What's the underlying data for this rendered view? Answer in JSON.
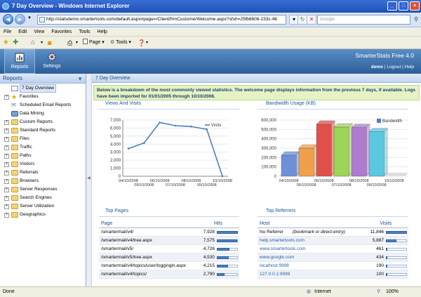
{
  "window": {
    "title": "7 Day Overview - Windows Internet Explorer"
  },
  "address": {
    "url": "http://statsdemo.smartertools.com/default.aspx#page=/Client/frmCustomerWelcome.aspx?sfsh=25fb6608-233c-46",
    "search_placeholder": "Google"
  },
  "menu": [
    "File",
    "Edit",
    "View",
    "Favorites",
    "Tools",
    "Help"
  ],
  "toolbar": {
    "page_label": "Page",
    "tools_label": "Tools"
  },
  "app": {
    "brand": "SmarterStats Free 4.0",
    "nav": [
      {
        "label": "Reports",
        "icon": "reports-icon"
      },
      {
        "label": "Settings",
        "icon": "gear-icon"
      }
    ],
    "user": "demo",
    "logout": "Logout",
    "help": "Help",
    "sep": "|"
  },
  "sidebar": {
    "title": "Reports",
    "items": [
      {
        "label": "7 Day Overview",
        "expander": false,
        "selected": true
      },
      {
        "label": "Favorites",
        "expander": true
      },
      {
        "label": "Scheduled Email Reports",
        "expander": false
      },
      {
        "label": "Data Mining",
        "expander": false
      },
      {
        "label": "Custom Reports",
        "expander": true
      },
      {
        "label": "Standard Reports",
        "expander": true
      },
      {
        "label": "Files",
        "expander": true
      },
      {
        "label": "Traffic",
        "expander": true
      },
      {
        "label": "Paths",
        "expander": true
      },
      {
        "label": "Visitors",
        "expander": true
      },
      {
        "label": "Referrals",
        "expander": true
      },
      {
        "label": "Browsers",
        "expander": true
      },
      {
        "label": "Server Responses",
        "expander": true
      },
      {
        "label": "Search Engines",
        "expander": true
      },
      {
        "label": "Server Utilization",
        "expander": true
      },
      {
        "label": "Geographics",
        "expander": true
      }
    ]
  },
  "main": {
    "title": "7 Day Overview",
    "info": "Below is a breakdown of the most commonly viewed statistics. The welcome page displays information from the previous 7 days, if available. Logs have been imported for 01/01/2005 through 10/10/2008.",
    "views_title": "Views And Visits",
    "bandwidth_title": "Bandwidth Usage (KB)",
    "top_pages_title": "Top Pages",
    "top_referrers_title": "Top Referrers",
    "pages_header": {
      "page": "Page",
      "hits": "Hits"
    },
    "referrers_header": {
      "host": "Host",
      "visits": "Visits"
    },
    "pages": [
      {
        "page": "/smartermail/v4/",
        "hits": "7,928",
        "frac": 1.0
      },
      {
        "page": "/smartermail/v4/tree.aspx",
        "hits": "7,575",
        "frac": 0.955
      },
      {
        "page": "/smartermail/v5/",
        "hits": "4,726",
        "frac": 0.596
      },
      {
        "page": "/smartermail/v5/tree.aspx",
        "hits": "4,530",
        "frac": 0.571
      },
      {
        "page": "/smartermail/v4/topics/user/loggingin.aspx",
        "hits": "4,215",
        "frac": 0.532
      },
      {
        "page": "/smartermail/v4/topics/",
        "hits": "2,790",
        "frac": 0.352
      }
    ],
    "referrers": [
      {
        "host": "No Referrer",
        "note": "(bookmark or direct-entry)",
        "visits": "11,846",
        "frac": 1.0,
        "link": false
      },
      {
        "host": "help.smartertools.com",
        "visits": "5,887",
        "frac": 0.497,
        "link": true
      },
      {
        "host": "www.smartertools.com",
        "visits": "461",
        "frac": 0.039,
        "link": true
      },
      {
        "host": "www.google.com",
        "visits": "434",
        "frac": 0.037,
        "link": true
      },
      {
        "host": "localhost:9998",
        "visits": "190",
        "frac": 0.016,
        "link": true
      },
      {
        "host": "127.0.0.1:9999",
        "visits": "100",
        "frac": 0.008,
        "link": true
      }
    ]
  },
  "chart_data": [
    {
      "type": "line",
      "title": "Views And Visits",
      "x": [
        "04/10/2008",
        "05/10/2008",
        "06/10/2008",
        "07/10/2008",
        "08/10/2008",
        "09/10/2008",
        "10/10/2008"
      ],
      "series": [
        {
          "name": "Visits",
          "values": [
            3450,
            4150,
            6700,
            6300,
            6200,
            5850,
            0
          ]
        }
      ],
      "ylim": [
        0,
        7000
      ],
      "yticks": [
        "0",
        "1,000",
        "2,000",
        "3,000",
        "4,000",
        "5,000",
        "6,000",
        "7,000"
      ],
      "color": "#4a7fc0",
      "legend": "top-right"
    },
    {
      "type": "bar",
      "title": "Bandwidth Usage (KB)",
      "categories": [
        "04/10/2008",
        "05/10/2008",
        "06/10/2008",
        "07/10/2008",
        "08/10/2008",
        "09/10/2008",
        "10/10/2008"
      ],
      "series": [
        {
          "name": "Bandwidth",
          "values": [
            225000,
            300000,
            555000,
            525000,
            520000,
            475000,
            0
          ]
        }
      ],
      "bar_colors": [
        "#6f8fd8",
        "#f0a04a",
        "#e0504a",
        "#9ed35a",
        "#b07ad0",
        "#5ac8e0",
        "#5ac8e0"
      ],
      "ylim": [
        0,
        600000
      ],
      "yticks": [
        "0",
        "100,000",
        "200,000",
        "300,000",
        "400,000",
        "500,000",
        "600,000"
      ],
      "legend": "top-right"
    }
  ],
  "status": {
    "left": "Done",
    "zone": "Internet",
    "zoom": "100%"
  }
}
